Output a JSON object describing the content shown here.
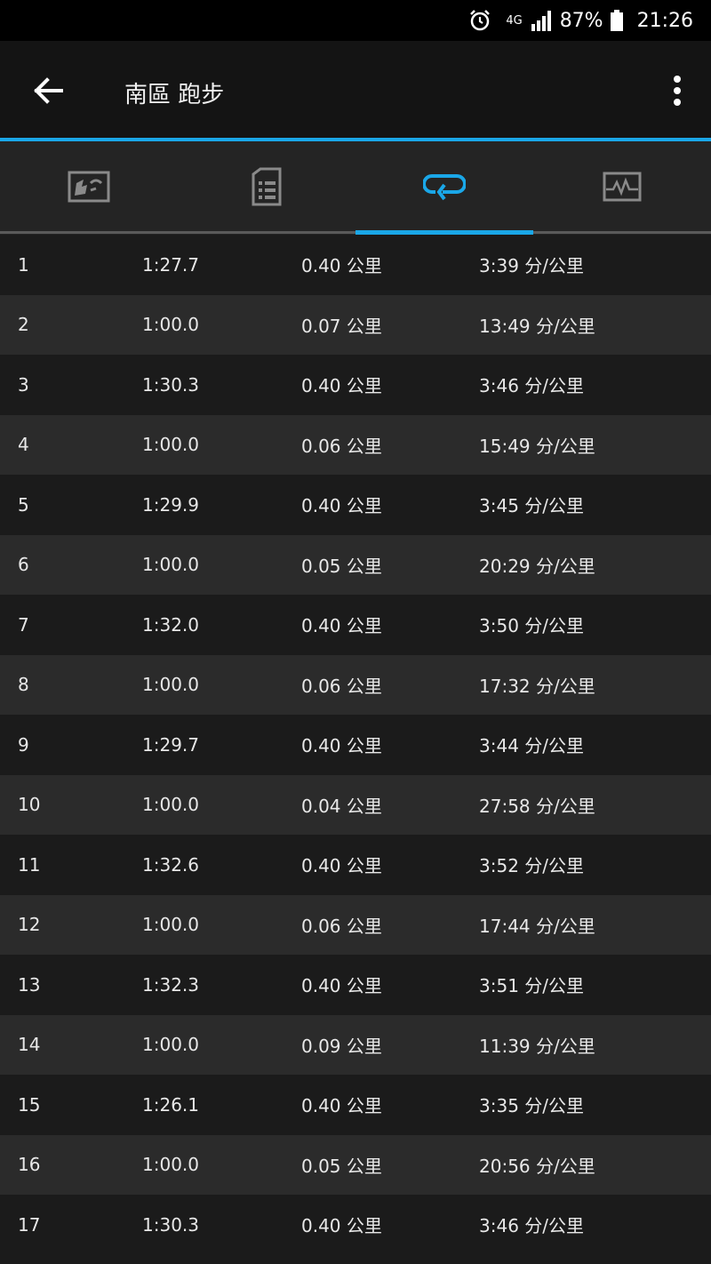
{
  "status_bar": {
    "network": "4G",
    "battery": "87%",
    "time": "21:26"
  },
  "header": {
    "title": "南區 跑步"
  },
  "tabs": [
    {
      "name": "map",
      "icon": "map-icon"
    },
    {
      "name": "details",
      "icon": "document-list-icon"
    },
    {
      "name": "laps",
      "icon": "laps-icon",
      "active": true
    },
    {
      "name": "charts",
      "icon": "chart-icon"
    }
  ],
  "colors": {
    "accent": "#1aa7e8"
  },
  "laps": [
    {
      "num": "1",
      "time": "1:27.7",
      "distance": "0.40 公里",
      "pace": "3:39 分/公里"
    },
    {
      "num": "2",
      "time": "1:00.0",
      "distance": "0.07 公里",
      "pace": "13:49 分/公里"
    },
    {
      "num": "3",
      "time": "1:30.3",
      "distance": "0.40 公里",
      "pace": "3:46 分/公里"
    },
    {
      "num": "4",
      "time": "1:00.0",
      "distance": "0.06 公里",
      "pace": "15:49 分/公里"
    },
    {
      "num": "5",
      "time": "1:29.9",
      "distance": "0.40 公里",
      "pace": "3:45 分/公里"
    },
    {
      "num": "6",
      "time": "1:00.0",
      "distance": "0.05 公里",
      "pace": "20:29 分/公里"
    },
    {
      "num": "7",
      "time": "1:32.0",
      "distance": "0.40 公里",
      "pace": "3:50 分/公里"
    },
    {
      "num": "8",
      "time": "1:00.0",
      "distance": "0.06 公里",
      "pace": "17:32 分/公里"
    },
    {
      "num": "9",
      "time": "1:29.7",
      "distance": "0.40 公里",
      "pace": "3:44 分/公里"
    },
    {
      "num": "10",
      "time": "1:00.0",
      "distance": "0.04 公里",
      "pace": "27:58 分/公里"
    },
    {
      "num": "11",
      "time": "1:32.6",
      "distance": "0.40 公里",
      "pace": "3:52 分/公里"
    },
    {
      "num": "12",
      "time": "1:00.0",
      "distance": "0.06 公里",
      "pace": "17:44 分/公里"
    },
    {
      "num": "13",
      "time": "1:32.3",
      "distance": "0.40 公里",
      "pace": "3:51 分/公里"
    },
    {
      "num": "14",
      "time": "1:00.0",
      "distance": "0.09 公里",
      "pace": "11:39 分/公里"
    },
    {
      "num": "15",
      "time": "1:26.1",
      "distance": "0.40 公里",
      "pace": "3:35 分/公里"
    },
    {
      "num": "16",
      "time": "1:00.0",
      "distance": "0.05 公里",
      "pace": "20:56 分/公里"
    },
    {
      "num": "17",
      "time": "1:30.3",
      "distance": "0.40 公里",
      "pace": "3:46 分/公里"
    }
  ]
}
